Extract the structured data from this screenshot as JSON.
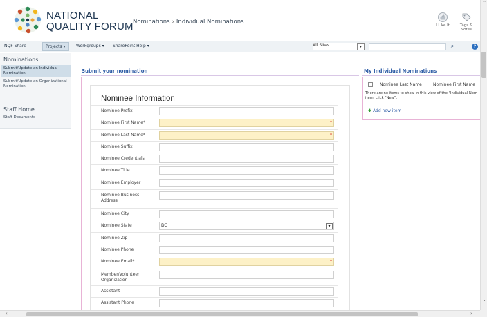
{
  "header": {
    "logo_line1": "NATIONAL",
    "logo_line2": "QUALITY FORUM",
    "breadcrumb": [
      "Nominations",
      "Individual Nominations"
    ],
    "breadcrumb_sep": "›",
    "like_label": "I Like It",
    "tags_label": "Tags & Notes"
  },
  "topnav": {
    "items": [
      "NQF Share",
      "Projects ▾",
      "Workgroups ▾",
      "SharePoint Help ▾"
    ],
    "active_index": 1,
    "search_scope": "All Sites",
    "search_placeholder": "",
    "help_label": "?"
  },
  "leftnav": {
    "heading": "Nominations",
    "links": [
      "Submit/Update an Individual Nomination",
      "Submit/Update an Organizational Nomination"
    ],
    "selected_index": 0,
    "heading2": "Staff Home",
    "links2": [
      "Staff Documents"
    ]
  },
  "main": {
    "section_title": "Submit your nomination",
    "form_title": "Nominee Information",
    "fields": [
      {
        "label": "Nominee Prefix",
        "value": "",
        "required": false
      },
      {
        "label": "Nominee First Name*",
        "value": "",
        "required": true
      },
      {
        "label": "Nominee Last Name*",
        "value": "",
        "required": true
      },
      {
        "label": "Nominee Suffix",
        "value": "",
        "required": false
      },
      {
        "label": "Nominee Credentials",
        "value": "",
        "required": false
      },
      {
        "label": "Nominee Title",
        "value": "",
        "required": false
      },
      {
        "label": "Nominee Employer",
        "value": "",
        "required": false
      },
      {
        "label": "Nominee Business Address",
        "value": "",
        "required": false
      },
      {
        "label": "Nominee City",
        "value": "",
        "required": false
      },
      {
        "label": "Nominee State",
        "value": "DC",
        "required": false,
        "select": true
      },
      {
        "label": "Nominee Zip",
        "value": "",
        "required": false
      },
      {
        "label": "Nominee Phone",
        "value": "",
        "required": false
      },
      {
        "label": "Nominee Email*",
        "value": "",
        "required": true
      },
      {
        "label": "Member/Volunteer Organization",
        "value": "",
        "required": false
      },
      {
        "label": "Assistant",
        "value": "",
        "required": false
      },
      {
        "label": "Assistant Phone",
        "value": "",
        "required": false
      }
    ]
  },
  "webpart": {
    "title": "My Individual Nominations",
    "col1": "Nominee Last Name",
    "col2": "Nominee First Name",
    "empty_text": "There are no items to show in this view of the \"Individual Nom item, click \"New\".",
    "add_label": "Add new item"
  },
  "colors": {
    "accent": "#2f5da6",
    "required_bg": "#fdf1c7",
    "frame": "#e8b3d6"
  }
}
